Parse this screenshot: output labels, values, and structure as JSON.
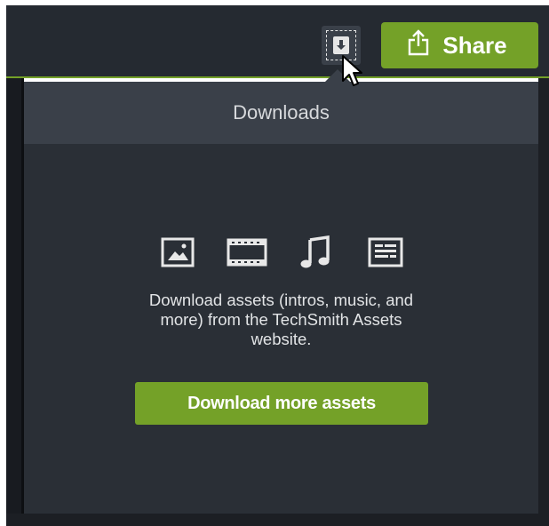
{
  "toolbar": {
    "download_button_icon": "download-icon",
    "share_label": "Share",
    "share_icon": "share-upload-icon"
  },
  "downloads_panel": {
    "title": "Downloads",
    "asset_icons": [
      "image-icon",
      "film-icon",
      "music-note-icon",
      "caption-icon"
    ],
    "description_lines": [
      "Download assets (intros, music, and",
      "more) from the TechSmith Assets",
      "website."
    ],
    "button_label": "Download more assets"
  },
  "colors": {
    "accent_green": "#74a128",
    "toolbar_bg": "#252a31",
    "panel_bg": "#2a2f36",
    "panel_header_bg": "#3a4049"
  }
}
